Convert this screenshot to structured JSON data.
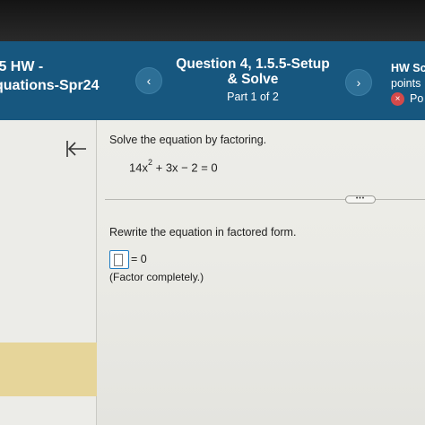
{
  "header": {
    "assignment_line1": ".5 HW -",
    "assignment_line2": "quations-Spr24",
    "prev_glyph": "‹",
    "next_glyph": "›",
    "question_line1": "Question 4, 1.5.5-Setup",
    "question_line2": "& Solve",
    "part": "Part 1 of 2",
    "right_line1": "HW Sc",
    "right_line2": "points",
    "right_line3": "Po",
    "status_icon": "x-circle-icon",
    "status_glyph": "×"
  },
  "left_panel": {
    "collapse_icon": "collapse-left-icon"
  },
  "question": {
    "instruction": "Solve the equation by factoring.",
    "equation_coef": "14x",
    "equation_exp": "2",
    "equation_rest": "+ 3x − 2 = 0",
    "more_label": "•••",
    "rewrite": "Rewrite the equation in factored form.",
    "answer_value": "",
    "answer_suffix": "= 0",
    "factor_note": "(Factor completely.)"
  },
  "colors": {
    "header_bg": "#17577f",
    "input_border": "#1e7cc4",
    "status_red": "#d44a4a",
    "highlight": "#e6d59a"
  }
}
